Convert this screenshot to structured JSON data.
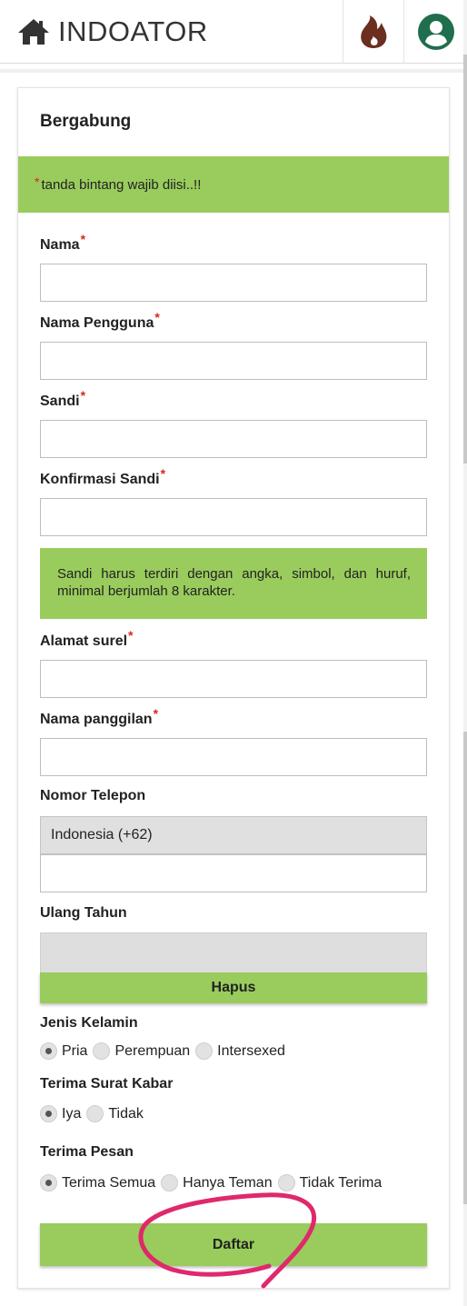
{
  "header": {
    "brand": "INDOATOR",
    "home_icon": "home-icon",
    "fire_icon": "fire-icon",
    "user_icon": "user-circle-icon",
    "fire_color": "#6b2e1f",
    "user_color": "#1f6e4e"
  },
  "form": {
    "title": "Bergabung",
    "required_note": "tanda bintang wajib diisi..!!",
    "required_star": "*",
    "fields": {
      "nama": "Nama",
      "nama_pengguna": "Nama Pengguna",
      "sandi": "Sandi",
      "konfirmasi_sandi": "Konfirmasi Sandi",
      "alamat_surel": "Alamat surel",
      "nama_panggilan": "Nama panggilan",
      "nomor_telepon": "Nomor Telepon",
      "ulang_tahun": "Ulang Tahun"
    },
    "password_hint": "Sandi harus terdiri dengan angka, simbol, dan huruf, minimal berjumlah 8 karakter.",
    "country_select": "Indonesia (+62)",
    "clear_button": "Hapus",
    "gender": {
      "label": "Jenis Kelamin",
      "options": [
        "Pria",
        "Perempuan",
        "Intersexed"
      ],
      "selected": "Pria"
    },
    "newsletter": {
      "label": "Terima Surat Kabar",
      "options": [
        "Iya",
        "Tidak"
      ],
      "selected": "Iya"
    },
    "messages": {
      "label": "Terima Pesan",
      "options": [
        "Terima Semua",
        "Hanya Teman",
        "Tidak Terima"
      ],
      "selected": "Terima Semua"
    },
    "submit_button": "Daftar"
  },
  "colors": {
    "accent_green": "#99cc5d",
    "required_red": "#d9261c",
    "annotation_pink": "#e0286d"
  }
}
